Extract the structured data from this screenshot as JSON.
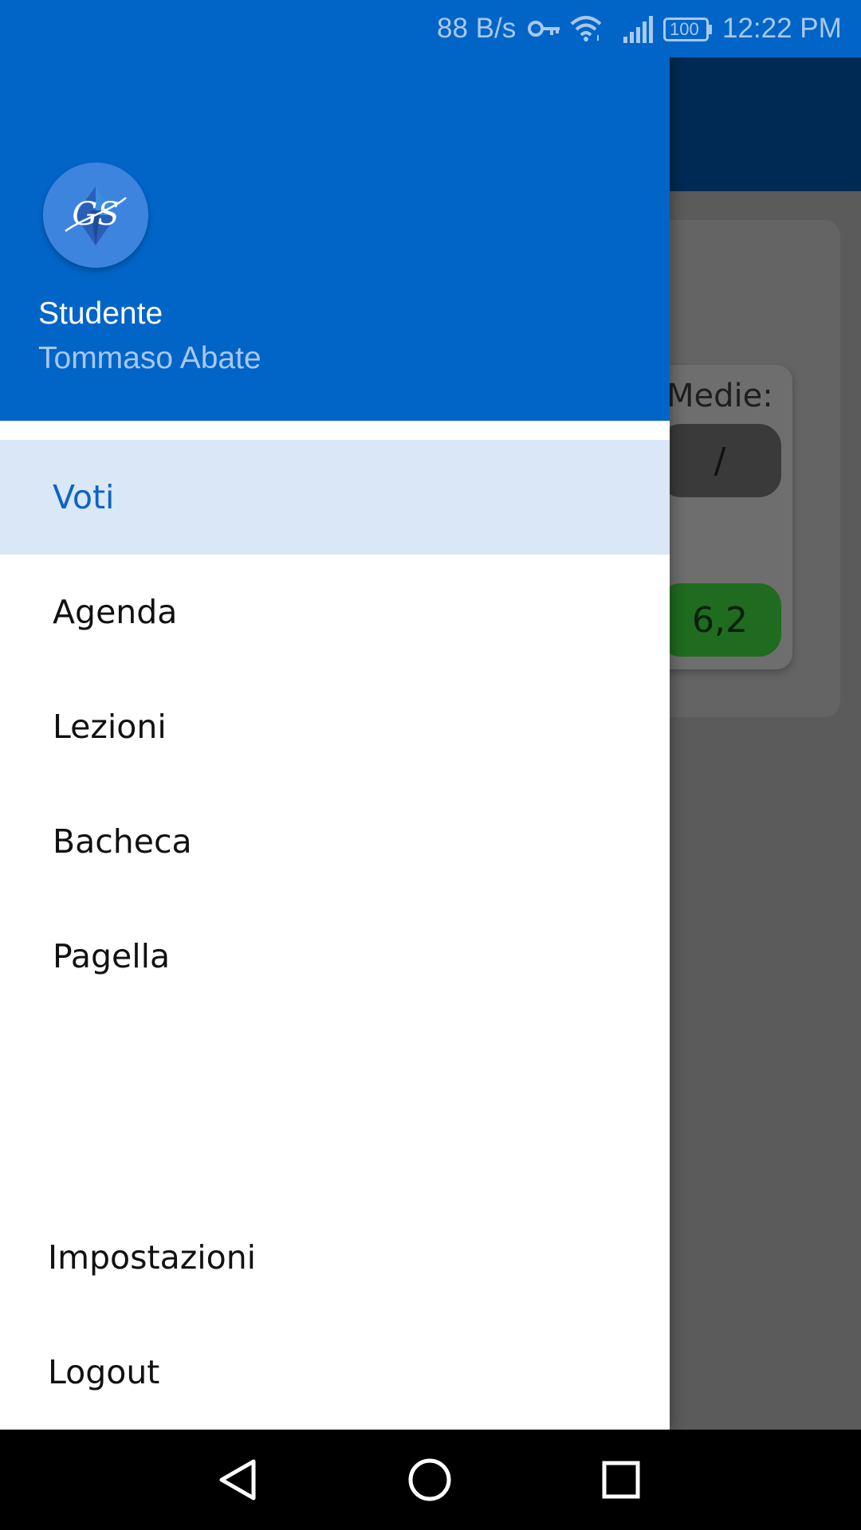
{
  "status_bar": {
    "net_speed": "88 B/s",
    "battery": "100",
    "time": "12:22 PM",
    "icons": [
      "vpn-key-icon",
      "wifi-icon",
      "signal-icon",
      "battery-icon"
    ]
  },
  "background": {
    "medie_label": "Medie:",
    "pill_1": "/",
    "pill_2": "6,2"
  },
  "drawer": {
    "header": {
      "role": "Studente",
      "name": "Tommaso Abate",
      "logo_text": "GS"
    },
    "items": [
      {
        "label": "Voti",
        "active": true
      },
      {
        "label": "Agenda"
      },
      {
        "label": "Lezioni"
      },
      {
        "label": "Bacheca"
      },
      {
        "label": "Pagella"
      }
    ],
    "footer_items": [
      {
        "label": "Impostazioni"
      },
      {
        "label": "Logout"
      }
    ]
  },
  "colors": {
    "primary": "#0065c7",
    "active_bg": "#d9e7f6",
    "active_text": "#0d63c4",
    "toolbar_dim": "#002a54"
  }
}
